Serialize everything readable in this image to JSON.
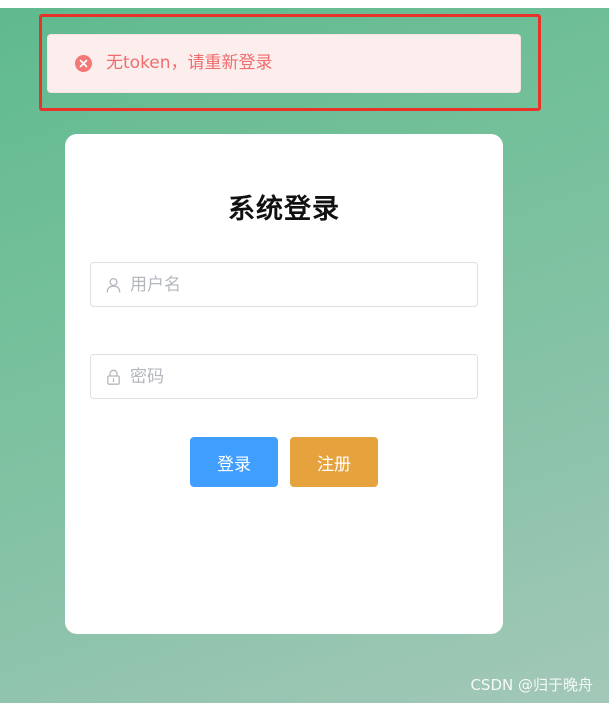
{
  "alert": {
    "icon": "error-circle-icon",
    "message": "无token，请重新登录",
    "color": "#f16c6c",
    "background": "#fdeeee"
  },
  "login_card": {
    "title": "系统登录",
    "username": {
      "icon": "user-icon",
      "placeholder": "用户名",
      "value": ""
    },
    "password": {
      "icon": "lock-icon",
      "placeholder": "密码",
      "value": ""
    },
    "buttons": {
      "login_label": "登录",
      "login_color": "#409eff",
      "register_label": "注册",
      "register_color": "#e6a23c"
    }
  },
  "watermark": "CSDN @归于晚舟",
  "colors": {
    "highlight_frame": "#e8322a",
    "background_start": "#5fba8e",
    "background_end": "#a3c8b8"
  }
}
